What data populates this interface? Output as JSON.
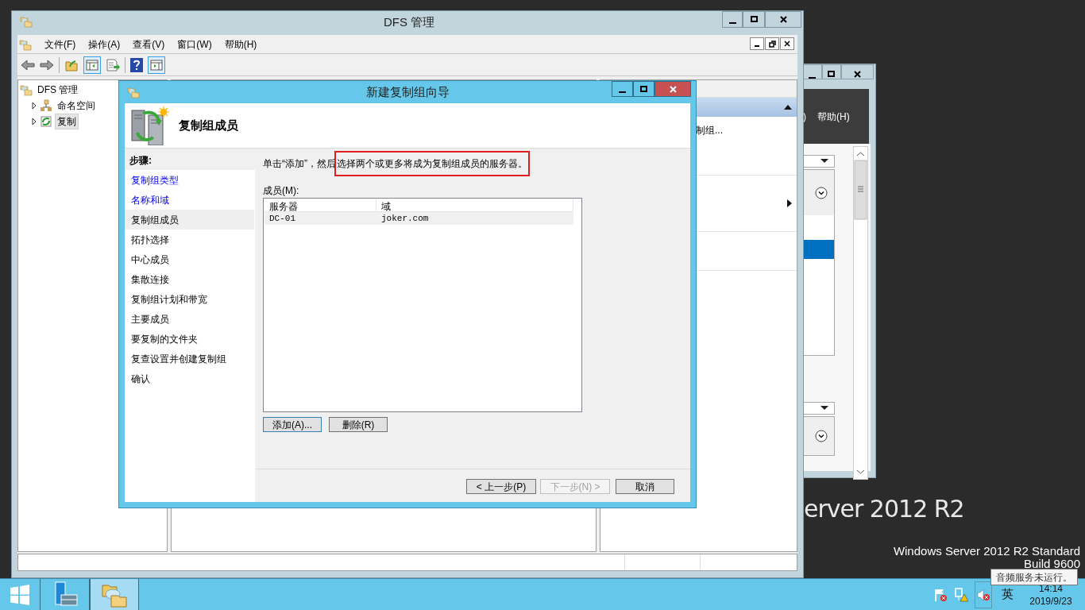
{
  "desktop": {
    "branding": "erver 2012 R2",
    "edition": "Windows Server 2012 R2 Standard",
    "build": "Build 9600"
  },
  "background_window": {
    "menu": [
      ")",
      "帮助(H)"
    ]
  },
  "main_window": {
    "title": "DFS 管理",
    "menu": [
      "文件(F)",
      "操作(A)",
      "查看(V)",
      "窗口(W)",
      "帮助(H)"
    ],
    "tree": [
      {
        "label": "DFS 管理",
        "selected": false,
        "children": [
          {
            "label": "命名空间",
            "expanded": false,
            "selected": false
          },
          {
            "label": "复制",
            "expanded": false,
            "selected": true
          }
        ]
      }
    ],
    "actions_item": "制组..."
  },
  "wizard": {
    "title": "新建复制组向导",
    "heading": "复制组成员",
    "steps_heading": "步骤:",
    "steps": [
      {
        "label": "复制组类型",
        "link": true,
        "selected": false
      },
      {
        "label": "名称和域",
        "link": true,
        "selected": false
      },
      {
        "label": "复制组成员",
        "link": false,
        "selected": true
      },
      {
        "label": "拓扑选择",
        "link": false,
        "selected": false
      },
      {
        "label": "中心成员",
        "link": false,
        "selected": false
      },
      {
        "label": "集散连接",
        "link": false,
        "selected": false
      },
      {
        "label": "复制组计划和带宽",
        "link": false,
        "selected": false
      },
      {
        "label": "主要成员",
        "link": false,
        "selected": false
      },
      {
        "label": "要复制的文件夹",
        "link": false,
        "selected": false
      },
      {
        "label": "复查设置并创建复制组",
        "link": false,
        "selected": false
      },
      {
        "label": "确认",
        "link": false,
        "selected": false
      }
    ],
    "instruction_lead": "单击“添加”，然后",
    "instruction_marked": "选择两个或更多将成为复制组成员的服务器。",
    "members_label": "成员(M):",
    "table": {
      "columns": [
        "服务器",
        "域"
      ],
      "rows": [
        {
          "cells": [
            "DC-01",
            "joker.com"
          ],
          "selected": true
        }
      ]
    },
    "list_buttons": [
      {
        "label": "添加(A)...",
        "focused": true
      },
      {
        "label": "删除(R)",
        "focused": false
      }
    ],
    "nav_buttons": [
      {
        "label": "< 上一步(P)",
        "disabled": false
      },
      {
        "label": "下一步(N) >",
        "disabled": true
      },
      {
        "label": "取消",
        "disabled": false
      }
    ]
  },
  "taskbar": {
    "items": [
      {
        "kind": "start",
        "selected": false
      },
      {
        "kind": "server-manager",
        "selected": false
      },
      {
        "kind": "dfs",
        "selected": true
      }
    ],
    "tooltip": "音频服务未运行。",
    "ime": "英",
    "time": "14:14",
    "date": "2019/9/23"
  }
}
